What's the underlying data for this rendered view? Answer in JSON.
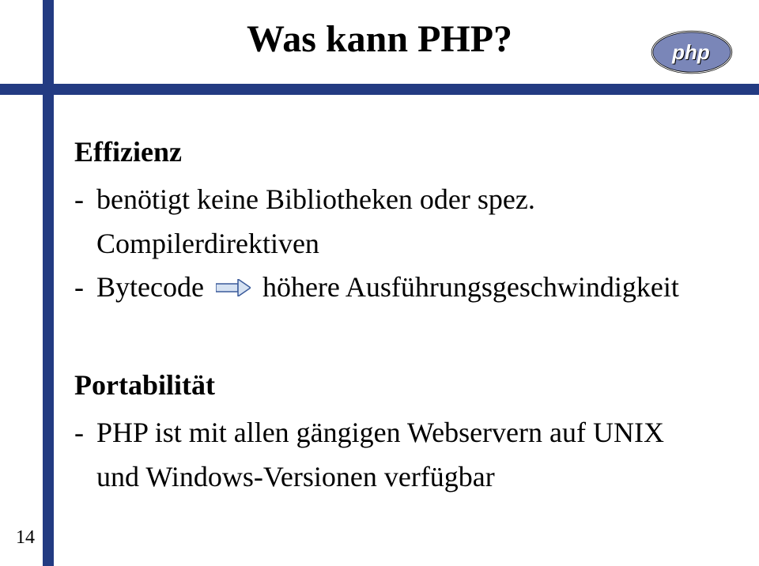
{
  "title": "Was kann PHP?",
  "section1": {
    "heading": "Effizienz",
    "bullet1_prefix": "benötigt keine Bibliotheken oder spez.",
    "bullet1_cont": "Compilerdirektiven",
    "bullet2_left": "Bytecode",
    "bullet2_right": "höhere Ausführungsgeschwindigkeit"
  },
  "section2": {
    "heading": "Portabilität",
    "bullet1_prefix": "PHP ist mit allen gängigen Webservern auf UNIX",
    "bullet1_cont": "und Windows-Versionen verfügbar"
  },
  "page_number": "14",
  "dash": "-"
}
